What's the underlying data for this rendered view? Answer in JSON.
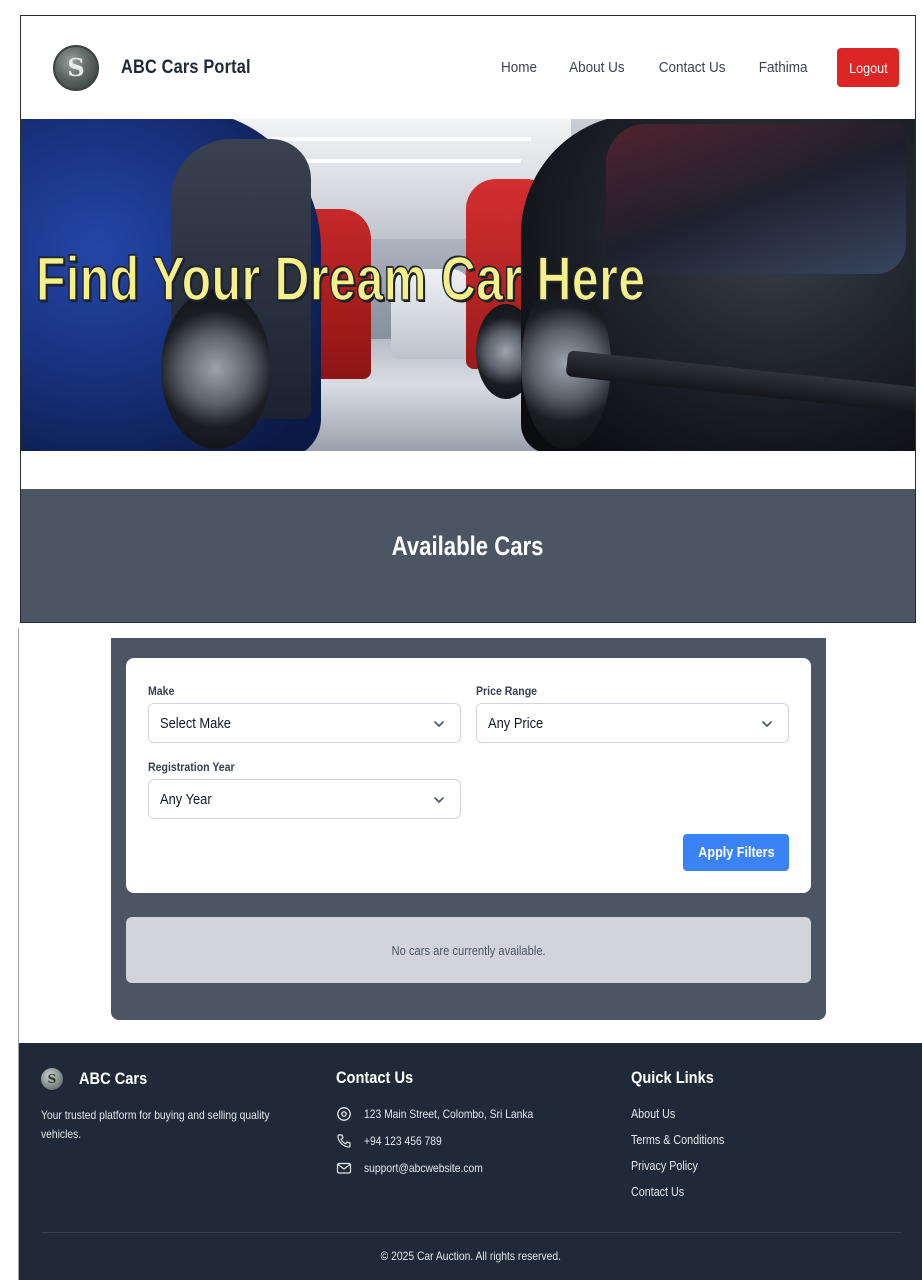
{
  "navbar": {
    "brand": "ABC Cars Portal",
    "logo_letter": "S",
    "links": [
      "Home",
      "About Us",
      "Contact Us",
      "Fathima"
    ],
    "logout_label": "Logout"
  },
  "hero": {
    "title": "Find Your Dream Car Here"
  },
  "available": {
    "title": "Available Cars"
  },
  "filters": {
    "make": {
      "label": "Make",
      "value": "Select Make"
    },
    "price": {
      "label": "Price Range",
      "value": "Any Price"
    },
    "year": {
      "label": "Registration Year",
      "value": "Any Year"
    },
    "apply_label": "Apply Filters"
  },
  "empty_message": "No cars are currently available.",
  "footer": {
    "brand": "ABC Cars",
    "description": "Your trusted platform for buying and selling quality vehicles.",
    "contact_heading": "Contact Us",
    "contact": {
      "address": "123 Main Street, Colombo, Sri Lanka",
      "phone": "+94 123 456 789",
      "email": "support@abcwebsite.com"
    },
    "links_heading": "Quick Links",
    "links": [
      "About Us",
      "Terms & Conditions",
      "Privacy Policy",
      "Contact Us"
    ],
    "copyright": "© 2025 Car Auction. All rights reserved."
  },
  "colors": {
    "logout": "#dc2626",
    "apply": "#3b82f6",
    "band": "#4b5563",
    "footer": "#1f2937",
    "hero_title": "#f6f08a"
  },
  "icons": {
    "address": "map-pin-icon",
    "phone": "phone-icon",
    "email": "mail-icon",
    "select": "chevron-down-icon"
  }
}
